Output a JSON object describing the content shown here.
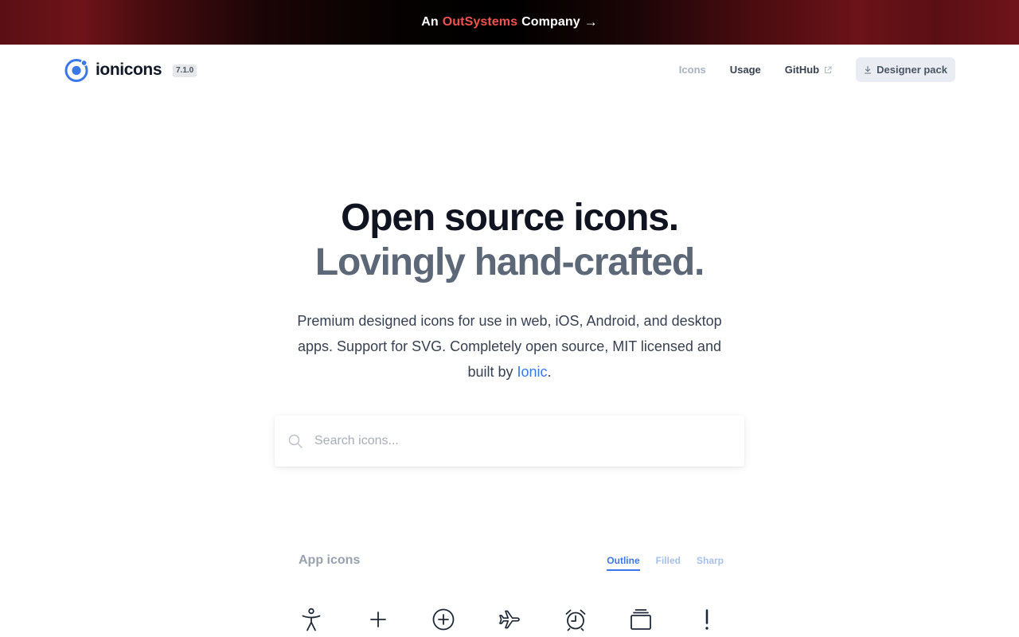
{
  "banner": {
    "prefix": "An",
    "brand": "OutSystems",
    "suffix": "Company",
    "arrow": "→",
    "brand_color": "#f0524f"
  },
  "header": {
    "logo_text": "ionicons",
    "version": "7.1.0",
    "nav": {
      "icons": "Icons",
      "usage": "Usage",
      "github": "GitHub",
      "designer_pack": "Designer pack"
    }
  },
  "hero": {
    "line1": "Open source icons.",
    "line2": "Lovingly hand-crafted.",
    "desc_before": "Premium designed icons for use in web, iOS, Android, and desktop apps. Support for SVG. Completely open source, MIT licensed and built by ",
    "desc_link": "Ionic",
    "desc_after": "."
  },
  "search": {
    "placeholder": "Search icons..."
  },
  "section": {
    "title": "App icons",
    "tabs": {
      "outline": "Outline",
      "filled": "Filled",
      "sharp": "Sharp"
    },
    "active_tab": "Outline",
    "icons": [
      "accessibility-icon",
      "add-icon",
      "add-circle-icon",
      "airplane-icon",
      "alarm-icon",
      "albums-icon",
      "alert-icon"
    ]
  },
  "colors": {
    "accent": "#3b78e7",
    "title_dark": "#0f1420",
    "title_muted": "#5c6878"
  }
}
